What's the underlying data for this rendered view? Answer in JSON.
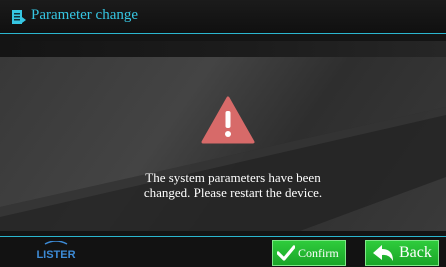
{
  "header": {
    "title": "Parameter change",
    "icon": "document-icon",
    "accent_color": "#36c6e2"
  },
  "main": {
    "icon": "warning-icon",
    "message_line1": "The system parameters have been",
    "message_line2": "changed. Please restart the device."
  },
  "footer": {
    "logo_text": "LISTER",
    "confirm_label": "Confirm",
    "back_label": "Back",
    "button_color": "#22b530"
  }
}
